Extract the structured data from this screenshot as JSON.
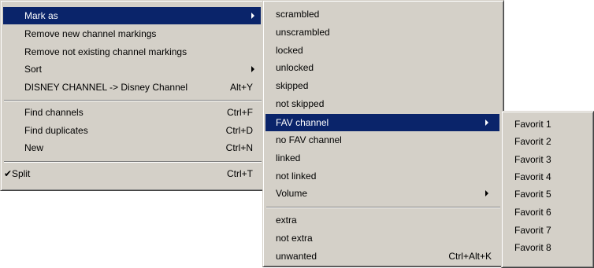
{
  "colors": {
    "menu_bg": "#d4d0c8",
    "highlight_bg": "#0a246a",
    "highlight_text": "#ffffff"
  },
  "menu": {
    "items": [
      {
        "label": "Mark as",
        "submenu": true,
        "highlighted": true
      },
      {
        "label": "Remove new channel markings"
      },
      {
        "label": "Remove not existing channel markings"
      },
      {
        "label": "Sort",
        "submenu": true
      },
      {
        "label": "DISNEY CHANNEL -> Disney Channel",
        "shortcut": "Alt+Y"
      },
      {
        "label": "Find channels",
        "shortcut": "Ctrl+F"
      },
      {
        "label": "Find duplicates",
        "shortcut": "Ctrl+D"
      },
      {
        "label": "New",
        "shortcut": "Ctrl+N"
      },
      {
        "label": "Split",
        "shortcut": "Ctrl+T",
        "checked": true
      }
    ]
  },
  "mark_as_menu": {
    "items": [
      {
        "label": "scrambled"
      },
      {
        "label": "unscrambled"
      },
      {
        "label": "locked"
      },
      {
        "label": "unlocked"
      },
      {
        "label": "skipped"
      },
      {
        "label": "not skipped"
      },
      {
        "label": "FAV channel",
        "submenu": true,
        "highlighted": true
      },
      {
        "label": "no FAV channel"
      },
      {
        "label": "linked"
      },
      {
        "label": "not linked"
      },
      {
        "label": "Volume",
        "submenu": true
      },
      {
        "label": "extra"
      },
      {
        "label": "not extra"
      },
      {
        "label": "unwanted",
        "shortcut": "Ctrl+Alt+K"
      }
    ]
  },
  "fav_menu": {
    "items": [
      {
        "label": "Favorit 1"
      },
      {
        "label": "Favorit 2"
      },
      {
        "label": "Favorit 3"
      },
      {
        "label": "Favorit 4"
      },
      {
        "label": "Favorit 5"
      },
      {
        "label": "Favorit 6"
      },
      {
        "label": "Favorit 7"
      },
      {
        "label": "Favorit 8"
      }
    ]
  },
  "check_glyph": "✔"
}
